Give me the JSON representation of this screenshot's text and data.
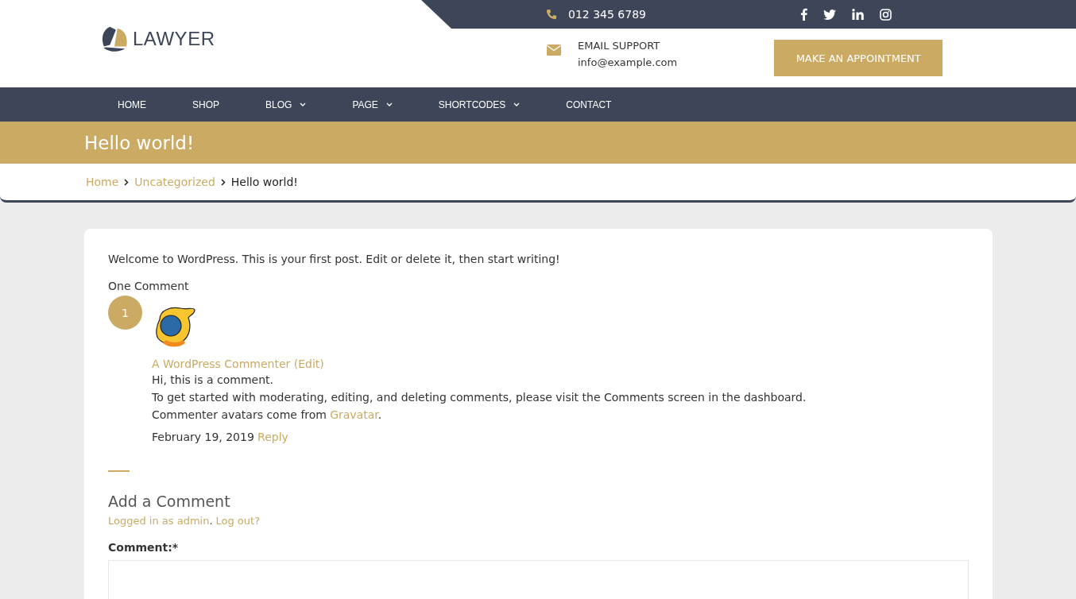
{
  "header": {
    "logo_text": "LAWYER",
    "phone": "012 345 6789",
    "social": [
      {
        "kind": "facebook"
      },
      {
        "kind": "twitter"
      },
      {
        "kind": "linkedin"
      },
      {
        "kind": "instagram"
      }
    ],
    "email_label": "EMAIL SUPPORT",
    "email": "info@example.com",
    "cta": "MAKE AN APPOINTMENT"
  },
  "nav": [
    {
      "label": "HOME",
      "has_submenu": false
    },
    {
      "label": "SHOP",
      "has_submenu": false
    },
    {
      "label": "BLOG",
      "has_submenu": true
    },
    {
      "label": "PAGE",
      "has_submenu": true
    },
    {
      "label": "SHORTCODES",
      "has_submenu": true
    },
    {
      "label": "CONTACT",
      "has_submenu": false
    }
  ],
  "page_title": "Hello world!",
  "breadcrumb": [
    {
      "label": "Home",
      "link": true
    },
    {
      "label": "Uncategorized",
      "link": true
    },
    {
      "label": "Hello world!",
      "link": false
    }
  ],
  "post": {
    "text": "Welcome to WordPress. This is your first post. Edit or delete it, then start writing!",
    "comments_heading": "One Comment",
    "comment": {
      "number": "1",
      "author": "A WordPress Commenter",
      "edit": "(Edit)",
      "lines": [
        "Hi, this is a comment.",
        "To get started with moderating, editing, and deleting comments, please visit the Comments screen in the dashboard."
      ],
      "avatars_text": "Commenter avatars come from",
      "avatars_link": "Gravatar",
      "avatars_end": ".",
      "date": "February 19, 2019",
      "reply": "Reply"
    },
    "form": {
      "heading": "Add a Comment",
      "logged_in": "Logged in as admin",
      "sep": ".",
      "logout": "Log out?",
      "label": "Comment:*"
    }
  }
}
